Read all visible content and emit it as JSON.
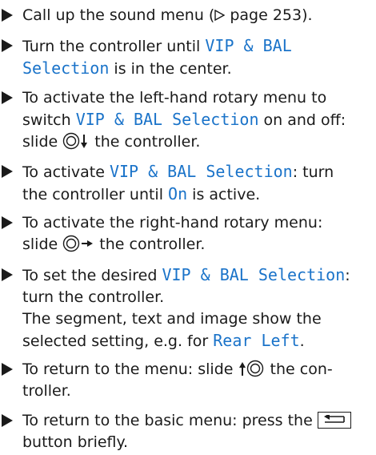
{
  "steps": [
    {
      "a": "Call up the sound menu (",
      "page_ref_icon": "triangle-right-outline-icon",
      "b": " page 253)."
    },
    {
      "a": "Turn the controller until ",
      "ui1": "VIP & BAL",
      "ui2": "Selection",
      "b": " is in the center."
    },
    {
      "a": "To activate the left-hand rotary menu to",
      "b": "switch ",
      "ui": "VIP & BAL Selection",
      "c": " on and off:",
      "d": "slide ",
      "controller_icon": "controller-slide-down-icon",
      "e": " the controller."
    },
    {
      "a": "To activate ",
      "ui": "VIP & BAL Selection",
      "b": ": turn",
      "c": "the controller until ",
      "ui2": "On",
      "d": " is active."
    },
    {
      "a": "To activate the right-hand rotary menu:",
      "b": "slide ",
      "controller_icon": "controller-slide-right-icon",
      "c": " the controller."
    },
    {
      "a": "To set the desired ",
      "ui": "VIP & BAL Selection",
      "b": ":",
      "c": "turn the controller.",
      "d": "The segment, text and image show the",
      "e": "selected setting, e.g. for ",
      "ui2": "Rear Left",
      "f": "."
    },
    {
      "a": "To return to the menu: slide ",
      "controller_icon": "controller-slide-up-icon",
      "b": " the con-",
      "c": "troller."
    },
    {
      "a": "To return to the basic menu: press the ",
      "button_icon": "back-button-icon",
      "b": "button briefly."
    }
  ],
  "colors": {
    "ui_text": "#1a73c9",
    "body_text": "#1a1a1a"
  }
}
